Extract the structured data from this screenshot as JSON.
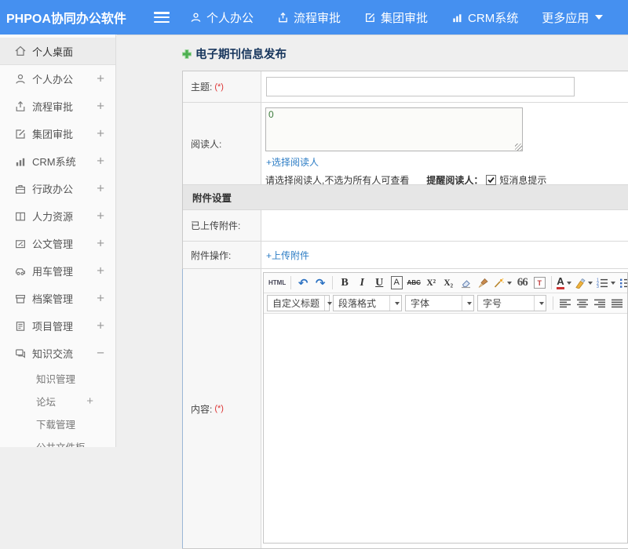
{
  "colors": {
    "topbar_blue": "#4590f0",
    "link_blue": "#2d7dc5",
    "title_navy": "#17365d",
    "required_red": "#dd3333",
    "section_gray": "#e6e6e6",
    "plus_green": "#4caf50"
  },
  "header": {
    "logo": "PHPOA协同办公软件",
    "nav": [
      {
        "label": "个人办公"
      },
      {
        "label": "流程审批"
      },
      {
        "label": "集团审批"
      },
      {
        "label": "CRM系统"
      },
      {
        "label": "更多应用"
      }
    ]
  },
  "sidebar": {
    "items": [
      {
        "label": "个人桌面",
        "expand": ""
      },
      {
        "label": "个人办公",
        "expand": "+"
      },
      {
        "label": "流程审批",
        "expand": "+"
      },
      {
        "label": "集团审批",
        "expand": "+"
      },
      {
        "label": "CRM系统",
        "expand": "+"
      },
      {
        "label": "行政办公",
        "expand": "+"
      },
      {
        "label": "人力资源",
        "expand": "+"
      },
      {
        "label": "公文管理",
        "expand": "+"
      },
      {
        "label": "用车管理",
        "expand": "+"
      },
      {
        "label": "档案管理",
        "expand": "+"
      },
      {
        "label": "项目管理",
        "expand": "+"
      },
      {
        "label": "知识交流",
        "expand": "−"
      }
    ],
    "subitems": [
      {
        "label": "知识管理",
        "expand": ""
      },
      {
        "label": "论坛",
        "expand": "+"
      },
      {
        "label": "下载管理",
        "expand": ""
      },
      {
        "label": "公共文件柜",
        "expand": ""
      }
    ]
  },
  "page": {
    "title": "电子期刊信息发布"
  },
  "form": {
    "subject_label": "主题:",
    "required_mark": "(*)",
    "readers_label": "阅读人:",
    "readers_value": "0",
    "select_readers_link": "+选择阅读人",
    "readers_note": "请选择阅读人,不选为所有人可查看",
    "remind_label": "提醒阅读人：",
    "sms_label": "短消息提示",
    "attachment_section_title": "附件设置",
    "uploaded_label": "已上传附件:",
    "attachment_op_label": "附件操作:",
    "upload_link": "+上传附件",
    "content_label": "内容:"
  },
  "editor": {
    "source_btn": "HTML",
    "bold": "B",
    "italic": "I",
    "underline": "U",
    "font_frame": "A",
    "strikethrough": "ABC",
    "superscript": "X²",
    "subscript": "X₂",
    "blockquote": "66",
    "template": "T",
    "forecolor": "A",
    "dropdowns": [
      "自定义标题",
      "段落格式",
      "字体",
      "字号"
    ],
    "icon_names": [
      "html-source",
      "undo",
      "redo",
      "bold",
      "italic",
      "underline",
      "font-frame",
      "strikethrough",
      "superscript",
      "subscript",
      "eraser",
      "format-brush",
      "magic-wand",
      "blockquote",
      "template",
      "forecolor",
      "highlight-pen",
      "ordered-list",
      "unordered-list",
      "align-left",
      "align-center",
      "align-right",
      "align-justify",
      "link",
      "unlink",
      "insert-image",
      "insert-images"
    ]
  }
}
